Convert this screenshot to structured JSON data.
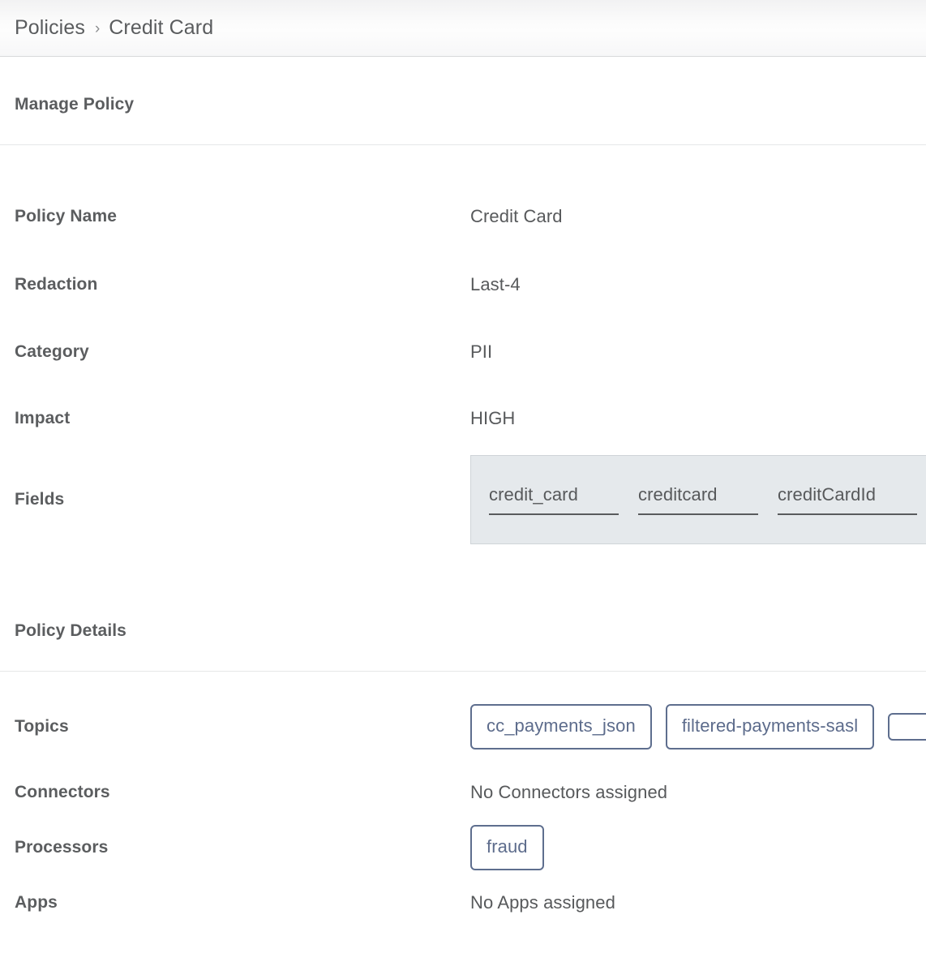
{
  "breadcrumb": {
    "root": "Policies",
    "separator": "›",
    "current": "Credit Card"
  },
  "sections": {
    "manage": {
      "title": "Manage Policy",
      "rows": {
        "policy_name": {
          "label": "Policy Name",
          "value": "Credit Card"
        },
        "redaction": {
          "label": "Redaction",
          "value": "Last-4"
        },
        "category": {
          "label": "Category",
          "value": "PII"
        },
        "impact": {
          "label": "Impact",
          "value": "HIGH"
        },
        "fields": {
          "label": "Fields",
          "values": [
            "credit_card",
            "creditcard",
            "creditCardId"
          ]
        }
      }
    },
    "details": {
      "title": "Policy Details",
      "rows": {
        "topics": {
          "label": "Topics",
          "chips": [
            "cc_payments_json",
            "filtered-payments-sasl",
            ""
          ]
        },
        "connectors": {
          "label": "Connectors",
          "value": "No Connectors assigned"
        },
        "processors": {
          "label": "Processors",
          "chips": [
            "fraud"
          ]
        },
        "apps": {
          "label": "Apps",
          "value": "No Apps assigned"
        }
      }
    }
  },
  "colors": {
    "label_text": "#5b5d5f",
    "value_text": "#57595b",
    "chip_border": "#5e6e8e",
    "chip_text": "#5d6c8c",
    "fields_box_bg": "#e5e9ec",
    "divider": "#e6e7e8"
  }
}
